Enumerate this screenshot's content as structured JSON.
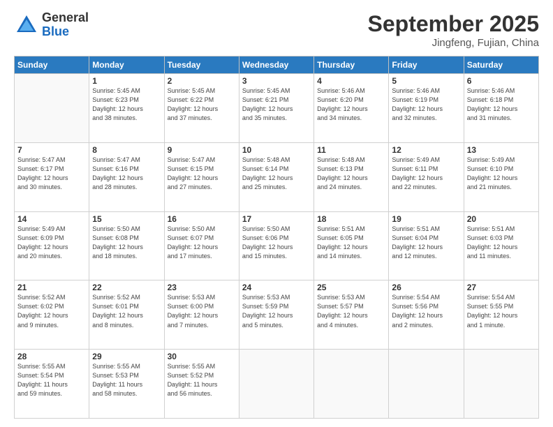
{
  "logo": {
    "general": "General",
    "blue": "Blue"
  },
  "header": {
    "month": "September 2025",
    "location": "Jingfeng, Fujian, China"
  },
  "weekdays": [
    "Sunday",
    "Monday",
    "Tuesday",
    "Wednesday",
    "Thursday",
    "Friday",
    "Saturday"
  ],
  "weeks": [
    [
      {
        "day": "",
        "info": ""
      },
      {
        "day": "1",
        "info": "Sunrise: 5:45 AM\nSunset: 6:23 PM\nDaylight: 12 hours\nand 38 minutes."
      },
      {
        "day": "2",
        "info": "Sunrise: 5:45 AM\nSunset: 6:22 PM\nDaylight: 12 hours\nand 37 minutes."
      },
      {
        "day": "3",
        "info": "Sunrise: 5:45 AM\nSunset: 6:21 PM\nDaylight: 12 hours\nand 35 minutes."
      },
      {
        "day": "4",
        "info": "Sunrise: 5:46 AM\nSunset: 6:20 PM\nDaylight: 12 hours\nand 34 minutes."
      },
      {
        "day": "5",
        "info": "Sunrise: 5:46 AM\nSunset: 6:19 PM\nDaylight: 12 hours\nand 32 minutes."
      },
      {
        "day": "6",
        "info": "Sunrise: 5:46 AM\nSunset: 6:18 PM\nDaylight: 12 hours\nand 31 minutes."
      }
    ],
    [
      {
        "day": "7",
        "info": "Sunrise: 5:47 AM\nSunset: 6:17 PM\nDaylight: 12 hours\nand 30 minutes."
      },
      {
        "day": "8",
        "info": "Sunrise: 5:47 AM\nSunset: 6:16 PM\nDaylight: 12 hours\nand 28 minutes."
      },
      {
        "day": "9",
        "info": "Sunrise: 5:47 AM\nSunset: 6:15 PM\nDaylight: 12 hours\nand 27 minutes."
      },
      {
        "day": "10",
        "info": "Sunrise: 5:48 AM\nSunset: 6:14 PM\nDaylight: 12 hours\nand 25 minutes."
      },
      {
        "day": "11",
        "info": "Sunrise: 5:48 AM\nSunset: 6:13 PM\nDaylight: 12 hours\nand 24 minutes."
      },
      {
        "day": "12",
        "info": "Sunrise: 5:49 AM\nSunset: 6:11 PM\nDaylight: 12 hours\nand 22 minutes."
      },
      {
        "day": "13",
        "info": "Sunrise: 5:49 AM\nSunset: 6:10 PM\nDaylight: 12 hours\nand 21 minutes."
      }
    ],
    [
      {
        "day": "14",
        "info": "Sunrise: 5:49 AM\nSunset: 6:09 PM\nDaylight: 12 hours\nand 20 minutes."
      },
      {
        "day": "15",
        "info": "Sunrise: 5:50 AM\nSunset: 6:08 PM\nDaylight: 12 hours\nand 18 minutes."
      },
      {
        "day": "16",
        "info": "Sunrise: 5:50 AM\nSunset: 6:07 PM\nDaylight: 12 hours\nand 17 minutes."
      },
      {
        "day": "17",
        "info": "Sunrise: 5:50 AM\nSunset: 6:06 PM\nDaylight: 12 hours\nand 15 minutes."
      },
      {
        "day": "18",
        "info": "Sunrise: 5:51 AM\nSunset: 6:05 PM\nDaylight: 12 hours\nand 14 minutes."
      },
      {
        "day": "19",
        "info": "Sunrise: 5:51 AM\nSunset: 6:04 PM\nDaylight: 12 hours\nand 12 minutes."
      },
      {
        "day": "20",
        "info": "Sunrise: 5:51 AM\nSunset: 6:03 PM\nDaylight: 12 hours\nand 11 minutes."
      }
    ],
    [
      {
        "day": "21",
        "info": "Sunrise: 5:52 AM\nSunset: 6:02 PM\nDaylight: 12 hours\nand 9 minutes."
      },
      {
        "day": "22",
        "info": "Sunrise: 5:52 AM\nSunset: 6:01 PM\nDaylight: 12 hours\nand 8 minutes."
      },
      {
        "day": "23",
        "info": "Sunrise: 5:53 AM\nSunset: 6:00 PM\nDaylight: 12 hours\nand 7 minutes."
      },
      {
        "day": "24",
        "info": "Sunrise: 5:53 AM\nSunset: 5:59 PM\nDaylight: 12 hours\nand 5 minutes."
      },
      {
        "day": "25",
        "info": "Sunrise: 5:53 AM\nSunset: 5:57 PM\nDaylight: 12 hours\nand 4 minutes."
      },
      {
        "day": "26",
        "info": "Sunrise: 5:54 AM\nSunset: 5:56 PM\nDaylight: 12 hours\nand 2 minutes."
      },
      {
        "day": "27",
        "info": "Sunrise: 5:54 AM\nSunset: 5:55 PM\nDaylight: 12 hours\nand 1 minute."
      }
    ],
    [
      {
        "day": "28",
        "info": "Sunrise: 5:55 AM\nSunset: 5:54 PM\nDaylight: 11 hours\nand 59 minutes."
      },
      {
        "day": "29",
        "info": "Sunrise: 5:55 AM\nSunset: 5:53 PM\nDaylight: 11 hours\nand 58 minutes."
      },
      {
        "day": "30",
        "info": "Sunrise: 5:55 AM\nSunset: 5:52 PM\nDaylight: 11 hours\nand 56 minutes."
      },
      {
        "day": "",
        "info": ""
      },
      {
        "day": "",
        "info": ""
      },
      {
        "day": "",
        "info": ""
      },
      {
        "day": "",
        "info": ""
      }
    ]
  ]
}
